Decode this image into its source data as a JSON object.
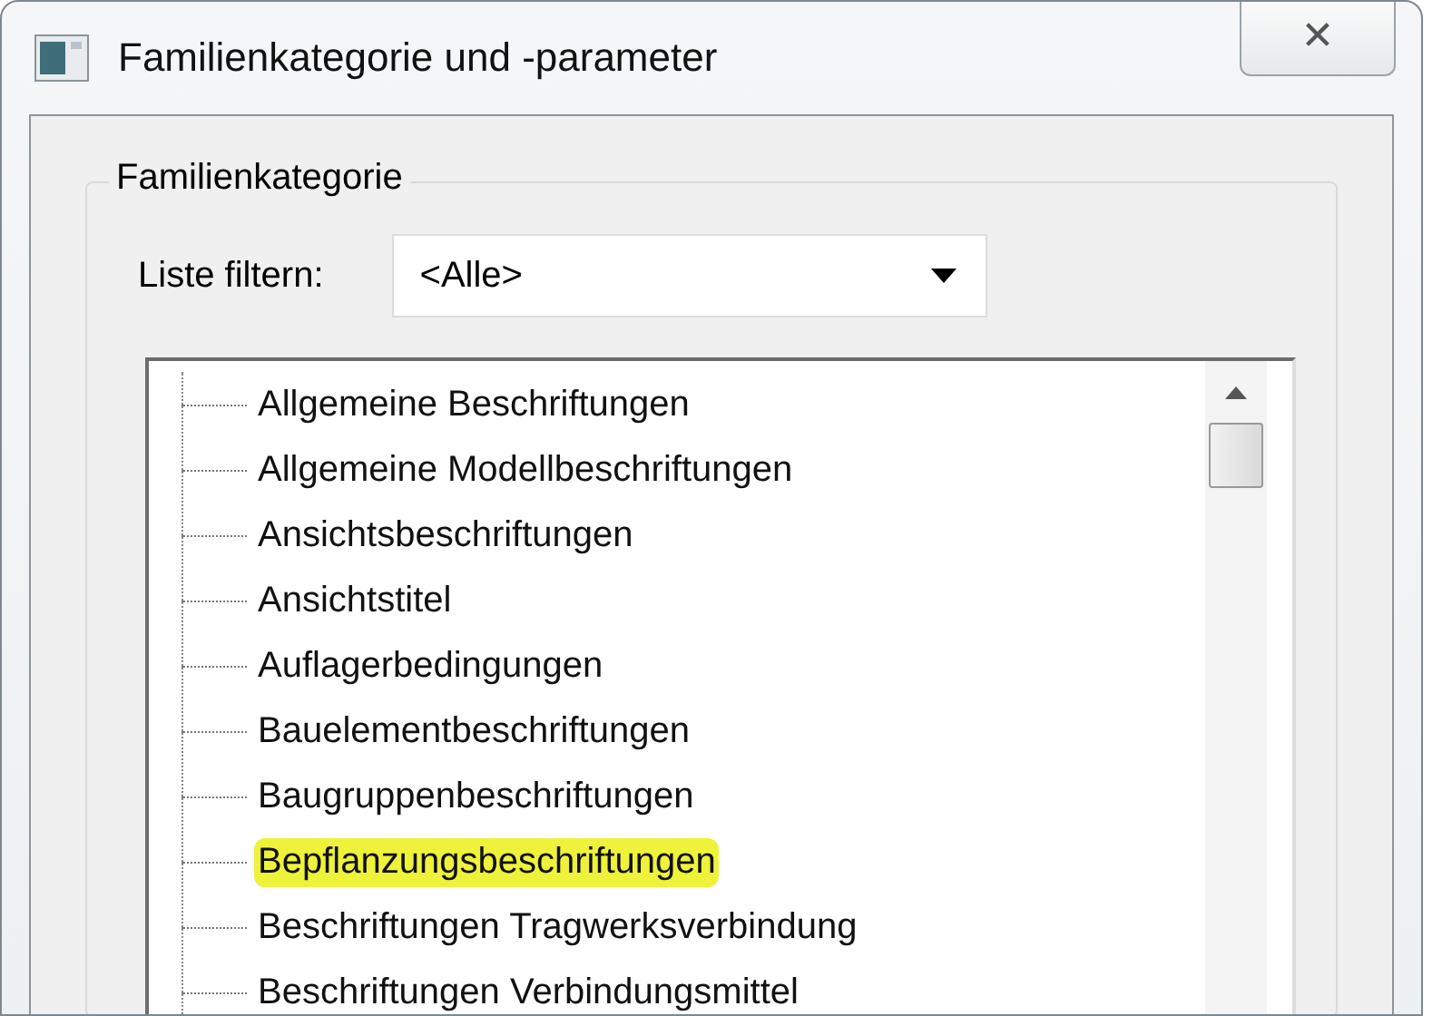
{
  "window": {
    "title": "Familienkategorie und -parameter",
    "close": "✕"
  },
  "group": {
    "label": "Familienkategorie",
    "filter": {
      "label": "Liste filtern:",
      "value": "<Alle>"
    },
    "tree": [
      {
        "label": "Allgemeine Beschriftungen",
        "highlighted": false
      },
      {
        "label": "Allgemeine Modellbeschriftungen",
        "highlighted": false
      },
      {
        "label": "Ansichtsbeschriftungen",
        "highlighted": false
      },
      {
        "label": "Ansichtstitel",
        "highlighted": false
      },
      {
        "label": "Auflagerbedingungen",
        "highlighted": false
      },
      {
        "label": "Bauelementbeschriftungen",
        "highlighted": false
      },
      {
        "label": "Baugruppenbeschriftungen",
        "highlighted": false
      },
      {
        "label": "Bepflanzungsbeschriftungen",
        "highlighted": true
      },
      {
        "label": "Beschriftungen Tragwerksverbindung",
        "highlighted": false
      },
      {
        "label": "Beschriftungen Verbindungsmittel",
        "highlighted": false
      }
    ]
  }
}
